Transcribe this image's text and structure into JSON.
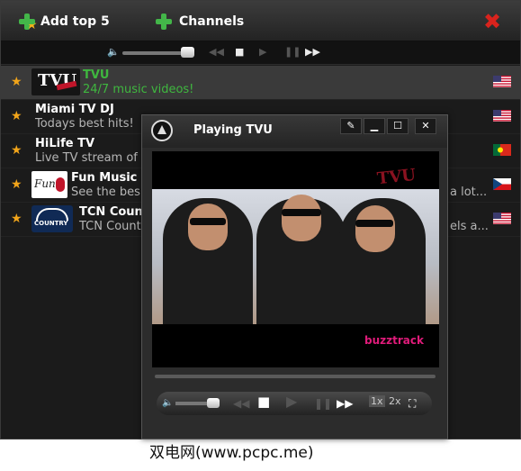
{
  "toolbar": {
    "add_top_label": "Add top 5",
    "channels_label": "Channels"
  },
  "channels": [
    {
      "name": "TVU",
      "desc": "24/7 music videos!",
      "logo_text": "TVU",
      "flag": "usa-flag",
      "selected": true
    },
    {
      "name": "Miami TV DJ",
      "desc": "Todays best hits!",
      "logo_text": "",
      "flag": "usa-flag",
      "selected": false
    },
    {
      "name": "HiLife TV",
      "desc": "Live TV stream of",
      "logo_text": "",
      "flag": "portugal-flag",
      "selected": false
    },
    {
      "name": "Fun Music",
      "desc": "See the bes",
      "desc_tail": "a lot...",
      "logo_text": "Fun",
      "flag": "czech-flag",
      "selected": false
    },
    {
      "name": "TCN Count",
      "desc": "TCN Count",
      "desc_tail": "els a...",
      "logo_text": "COUNTRY",
      "flag": "usa-flag",
      "selected": false
    }
  ],
  "player": {
    "title": "Playing TVU",
    "video_logo": "TVU",
    "video_caption": "buzztrack",
    "speed_1x": "1x",
    "speed_2x": "2x"
  },
  "watermark": "双电网(www.pcpc.me)",
  "colors": {
    "selected_text": "#3fb73f",
    "favorite_star": "#f2a51a",
    "close_red": "#d9231d",
    "plus_green": "#43b649"
  }
}
